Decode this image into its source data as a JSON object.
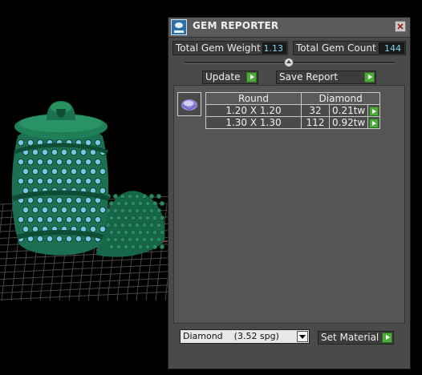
{
  "panel": {
    "title": "GEM REPORTER"
  },
  "stats": {
    "weight_label": "Total Gem Weight",
    "weight_value": "1.13",
    "count_label": "Total Gem Count",
    "count_value": "144"
  },
  "actions": {
    "update_label": "Update",
    "save_label": "Save Report"
  },
  "gem_table": {
    "headers": [
      "Round",
      "Diamond"
    ],
    "rows": [
      {
        "size": "1.20 X 1.20",
        "count": "32",
        "weight": "0.21tw"
      },
      {
        "size": "1.30 X 1.30",
        "count": "112",
        "weight": "0.92tw"
      }
    ]
  },
  "material": {
    "selected": "Diamond    (3.52 spg)",
    "set_label": "Set Material"
  },
  "colors": {
    "model_green": "#1d7a55",
    "gem_blue": "#7cc6e6",
    "play_green": "#4eaa3a",
    "value_text": "#7fd6f0"
  }
}
